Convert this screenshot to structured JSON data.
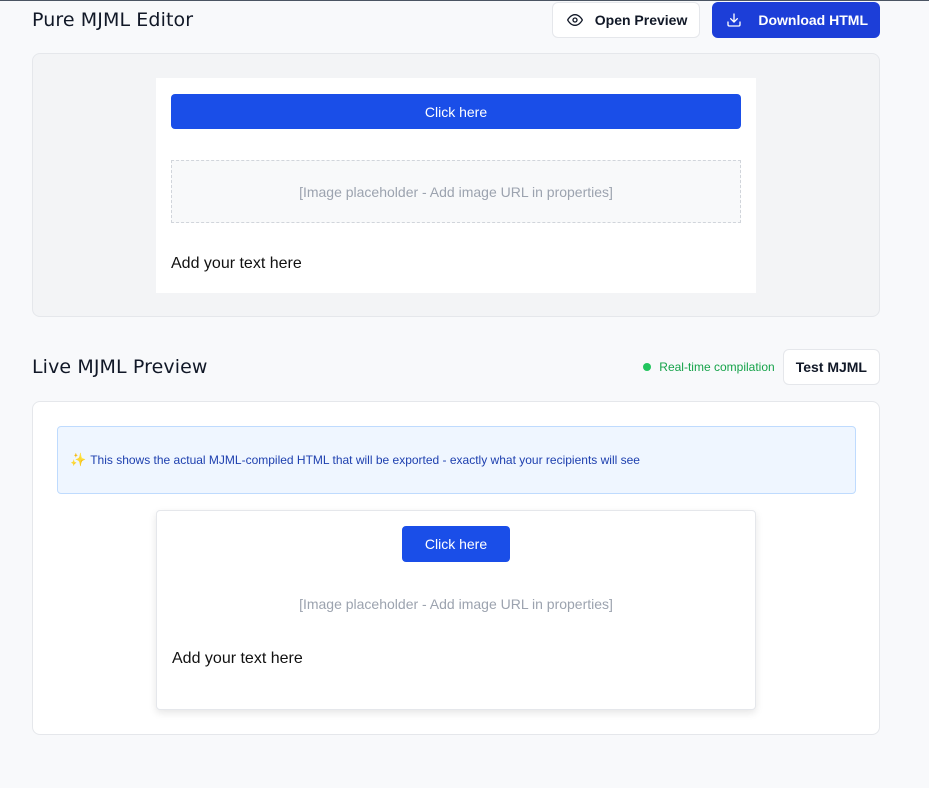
{
  "editor": {
    "title": "Pure MJML Editor",
    "open_preview_label": "Open Preview",
    "download_label": "Download HTML",
    "email": {
      "button_label": "Click here",
      "image_placeholder": "[Image placeholder - Add image URL in properties]",
      "text": "Add your text here"
    }
  },
  "preview": {
    "title": "Live MJML Preview",
    "status_text": "Real-time compilation",
    "test_label": "Test MJML",
    "info_text": "This shows the actual MJML-compiled HTML that will be exported - exactly what your recipients will see",
    "info_icon": "✨",
    "email": {
      "button_label": "Click here",
      "image_placeholder": "[Image placeholder - Add image URL in properties]",
      "text": "Add your text here"
    }
  },
  "colors": {
    "primary": "#1c3ed8",
    "email_button": "#1a4ee8",
    "status_green": "#22c55e",
    "info_bg": "#eff6ff"
  }
}
